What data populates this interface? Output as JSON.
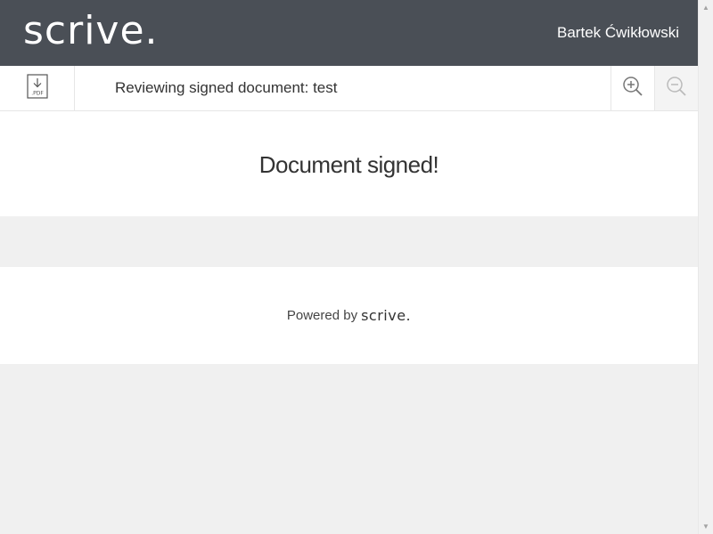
{
  "header": {
    "logo_text": "scrive.",
    "user_name": "Bartek Ćwikłowski",
    "background_color": "#4a4f56"
  },
  "toolbar": {
    "download_icon": "download-pdf-icon",
    "download_icon_label": ".PDF",
    "title": "Reviewing signed document: test",
    "zoom_in_icon": "zoom-in-icon",
    "zoom_out_icon": "zoom-out-icon"
  },
  "main": {
    "signed_message": "Document signed!"
  },
  "footer": {
    "powered_by": "Powered by",
    "powered_logo": "scrive."
  }
}
